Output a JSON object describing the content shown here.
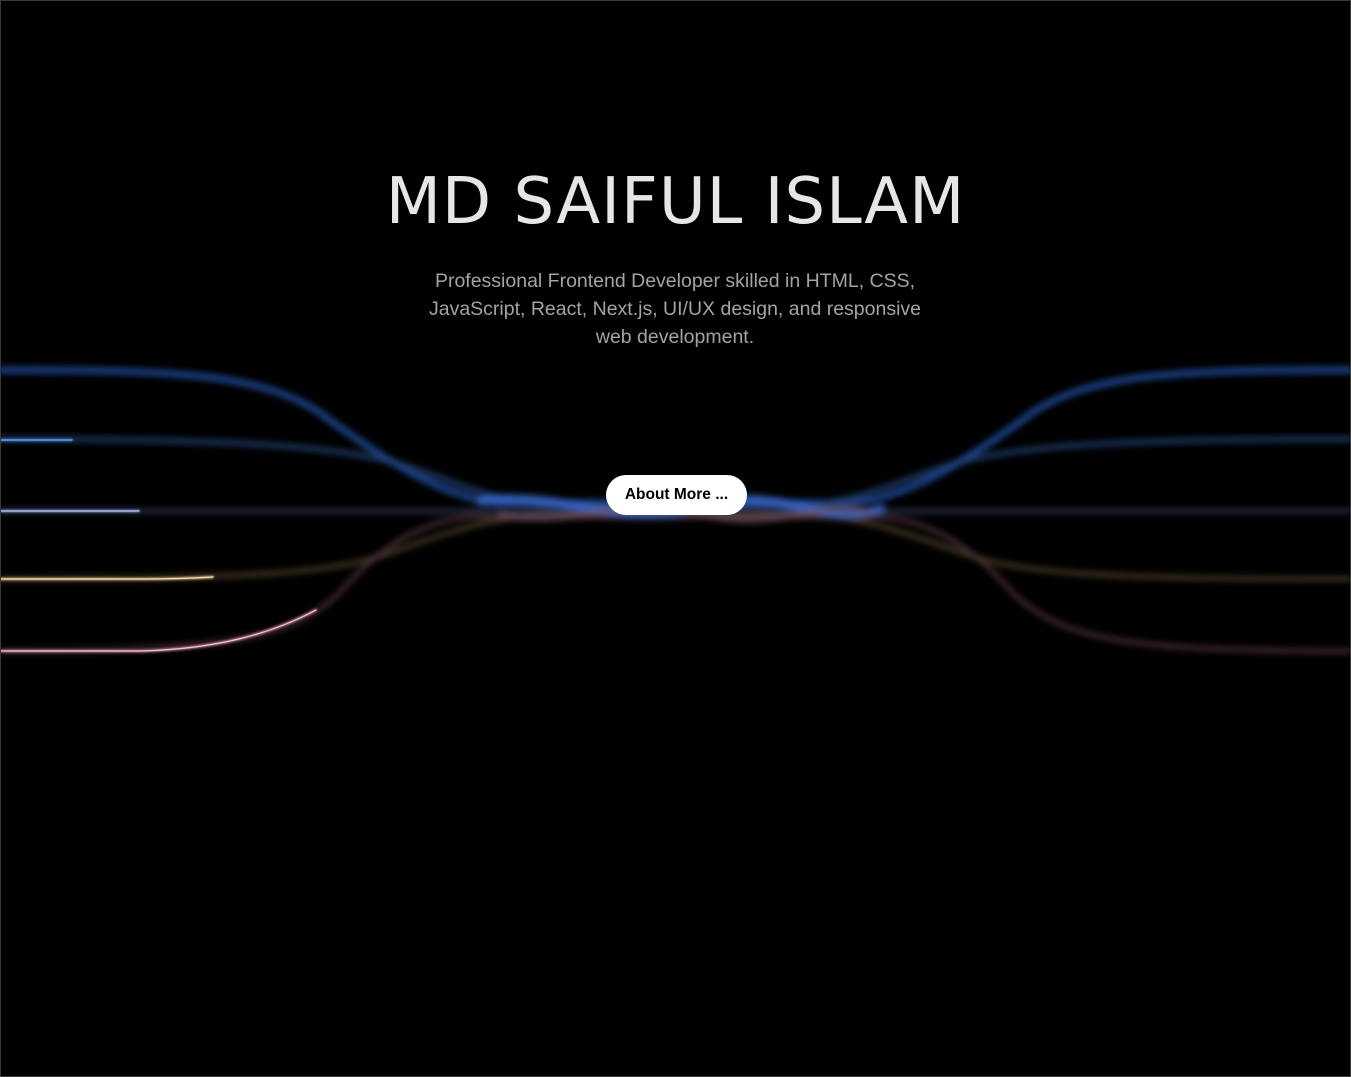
{
  "hero": {
    "title": "MD SAIFUL ISLAM",
    "subtitle": "Professional Frontend Developer skilled in HTML, CSS, JavaScript, React, Next.js, UI/UX design, and responsive web development.",
    "cta_label": "About More ..."
  },
  "theme": {
    "background": "#000000",
    "title_color": "#e6e6e6",
    "subtitle_color": "#a3a3a3",
    "button_bg": "#ffffff",
    "button_text": "#000000",
    "beam_colors": [
      "#2a6ad8",
      "#4a90e2",
      "#9aaef0",
      "#f2d49a",
      "#f0a8b8"
    ]
  }
}
